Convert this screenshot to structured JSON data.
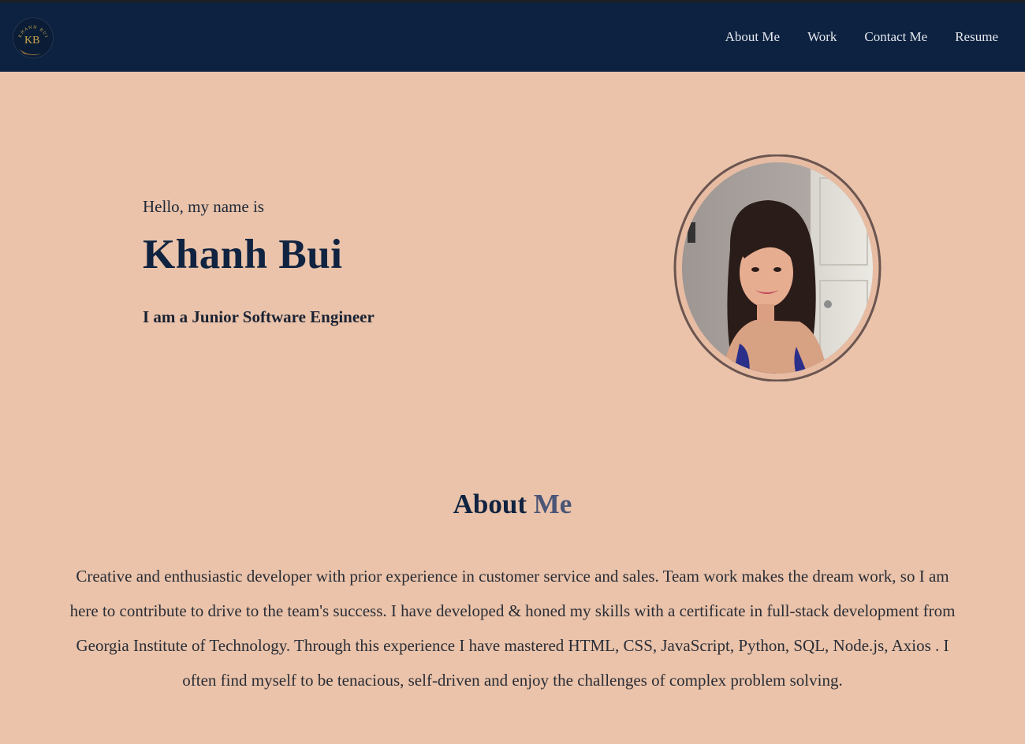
{
  "nav": {
    "logo": {
      "icon": "kb-monogram-logo",
      "text": "KHANH BUI",
      "monogram": "KB"
    },
    "links": [
      {
        "label": "About Me"
      },
      {
        "label": "Work"
      },
      {
        "label": "Contact Me"
      },
      {
        "label": "Resume"
      }
    ]
  },
  "hero": {
    "greeting": "Hello, my name is",
    "name": "Khanh Bui",
    "role": "I am a Junior Software Engineer"
  },
  "about": {
    "title_main": "About",
    "title_accent": "Me",
    "body": "Creative and enthusiastic developer with prior experience in customer service and sales. Team work makes the dream work, so I am here to contribute to drive to the team's success. I have developed & honed my skills with a certificate in full-stack development from Georgia Institute of Technology. Through this experience I have mastered HTML, CSS, JavaScript, Python, SQL, Node.js, Axios . I often find myself to be tenacious, self-driven and enjoy the challenges of complex problem solving."
  },
  "colors": {
    "navbar": "#0d2240",
    "page_background": "#eac3aa",
    "heading": "#102340",
    "accent": "#4a5577"
  }
}
